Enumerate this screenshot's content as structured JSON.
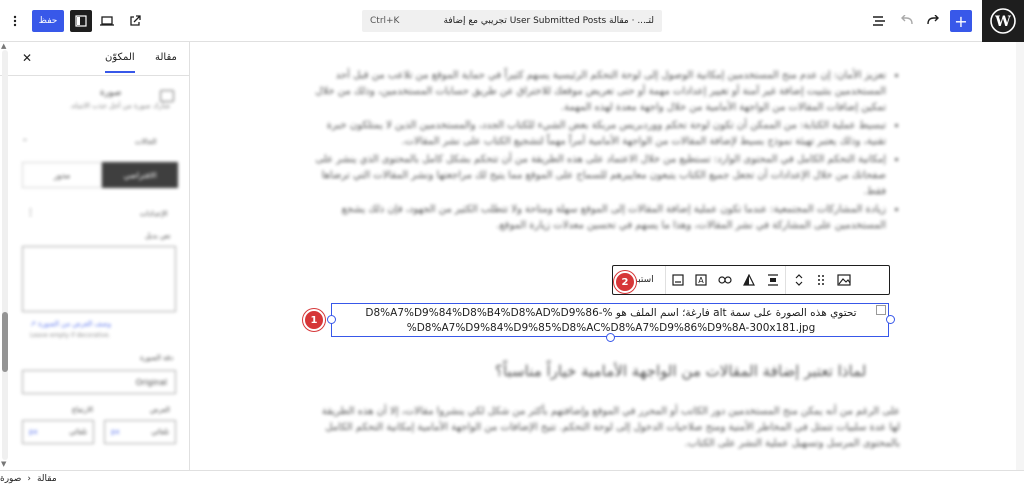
{
  "header": {
    "save_label": "حفظ",
    "command_bar": {
      "title": "تجريبي مع إضافة User Submitted Posts لتـ... · مقالة",
      "shortcut": "Ctrl+K"
    },
    "add_label": "+"
  },
  "sidebar": {
    "tabs": [
      "مقالة",
      "المكوّن"
    ],
    "active_tab": "المكوّن",
    "block_title": "صورة",
    "block_desc": "شارك صورة من أجل جذب الانتباه.",
    "styles_label": "الحالات",
    "style_options": [
      "الافتراضي",
      "مدور"
    ],
    "settings_label": "الإعدادات",
    "alt_label": "نص بديل",
    "alt_help_link": "وصف الغرض من الصورة ↗",
    "alt_help_text": "Leave empty if decorative.",
    "resolution_label": "دقة الصورة",
    "resolution_value": "Original",
    "width_label": "العرض",
    "height_label": "الارتفاع",
    "auto": "تلقائي",
    "unit": "px"
  },
  "article": {
    "bullets": [
      "تعزيز الأمان: إن عدم منح المستخدمين إمكانية الوصول إلى لوحة التحكم الرئيسية يسهم كثيراً في حماية الموقع من تلاعب من قبل أحد المستخدمين بتثبيت إضافة غير آمنة أو تغيير إعدادات مهمة أو حتى تعريض موقعك للاختراق عن طريق حسابات المستخدمين، وذلك من خلال تمكين إضافات المقالات من الواجهة الأمامية من خلال واجهة معدة لهذه المهمة.",
      "تبسيط عملية الكتابة: من الممكن أن تكون لوحة تحكم ووردبريس مربكة بعض الشيء للكتاب الجدد، والمستخدمين الذين لا يمتلكون خبرة تقنية، وذلك يعتبر تهيئة نموذج بسيط لإضافة المقالات من الواجهة الأمامية أمراً مهماً لتشجيع الكتاب على نشر المقالات.",
      "إمكانية التحكم الكامل في المحتوى الوارد: تستطيع من خلال الاعتماد على هذه الطريقة من أن تتحكم بشكل كامل بالمحتوى الذي ينشر على صفحاتك من خلال الإعدادات أن تجعل جميع الكتاب يتبعون معاييرهم للسماح على الموقع مما يتيح لك مراجعتها ونشر المقالات التي ترضاها فقط.",
      "زيادة المشاركات المجتمعية: عندما تكون عملية إضافة المقالات إلى الموقع سهلة ومتاحة ولا تتطلب الكثير من الجهود، فإن ذلك يشجع المستخدمين على المشاركة في نشر المقالات، وهذا ما يسهم في تحسين معدلات زيارة الموقع."
    ],
    "image_filename": "تحتوي هذه الصورة على سمة alt فارغة؛ اسم الملف هو %D8%A7%D9%84%D8%B4%D8%AD%D9%86-%D8%A7%D9%84%D9%85%D8%AC%D8%A7%D9%86%D9%8A-300x181.jpg",
    "h2": "لماذا تعتبر إضافة المقالات من الواجهة الأمامية خياراً مناسباً؟",
    "para": "على الرغم من أنه يمكن منح المستخدمين دور الكاتب أو المحرر في الموقع وإضافتهم بأكثر من شكل لكي ينشروا مقالات، إلا أن هذه الطريقة لها عدة سلبيات تتمثل في المخاطر الأمنية ومنح صلاحيات الدخول إلى لوحة التحكم. تتيح الإضافات من الواجهة الأمامية إمكانية التحكم الكامل بالمحتوى المرسل وتسهيل عملية النشر على الكتاب."
  },
  "toolbar": {
    "replace_label": "استبدال"
  },
  "badges": [
    "1",
    "2"
  ],
  "footer": {
    "crumbs": [
      "مقالة",
      "صورة"
    ]
  },
  "colors": {
    "accent": "#3858e9",
    "badge": "#d63638",
    "dark": "#1e1e1e"
  }
}
